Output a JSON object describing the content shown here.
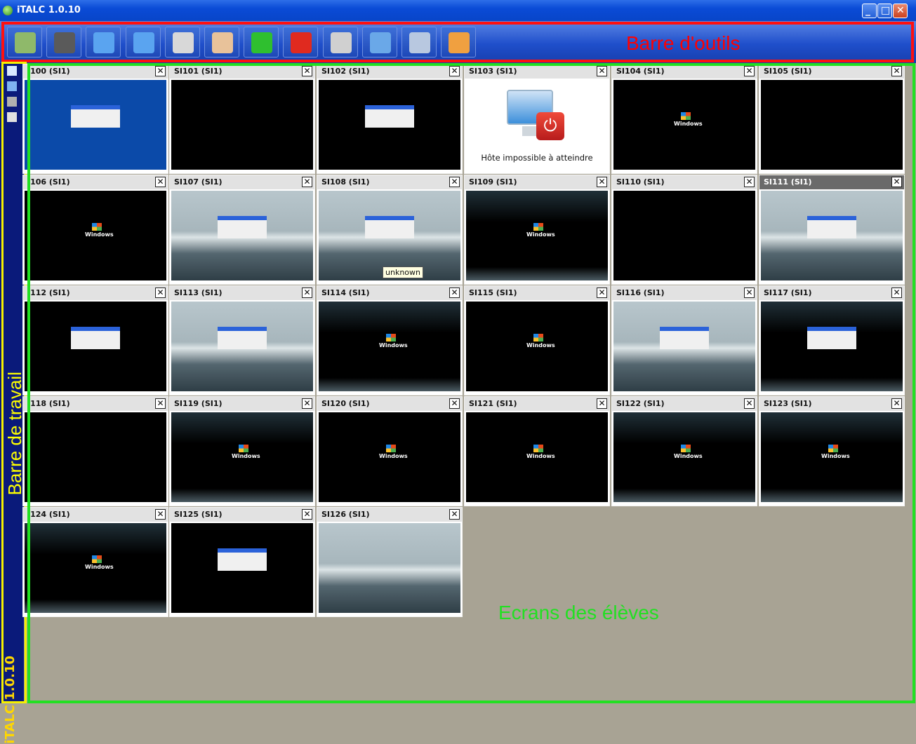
{
  "window": {
    "title": "iTALC 1.0.10"
  },
  "toolbar": {
    "label": "Barre d'outils",
    "buttons": [
      {
        "name": "classroom-button",
        "icon": "classroom-icon",
        "color": "#8fb96a"
      },
      {
        "name": "overview-button",
        "icon": "binoculars-icon",
        "color": "#5a5a5a"
      },
      {
        "name": "fullscreen-demo-button",
        "icon": "demo-icon",
        "color": "#5aa4f0"
      },
      {
        "name": "window-demo-button",
        "icon": "window-demo-icon",
        "color": "#5aa4f0"
      },
      {
        "name": "lock-button",
        "icon": "lock-icon",
        "color": "#d8d8d8"
      },
      {
        "name": "message-button",
        "icon": "message-icon",
        "color": "#e8c29a"
      },
      {
        "name": "power-on-button",
        "icon": "power-on-icon",
        "color": "#2fbf2f"
      },
      {
        "name": "power-off-button",
        "icon": "power-off-icon",
        "color": "#e02a1f"
      },
      {
        "name": "logon-button",
        "icon": "logon-icon",
        "color": "#d0d0d0"
      },
      {
        "name": "remote-control-button",
        "icon": "remote-control-icon",
        "color": "#6aa8e8"
      },
      {
        "name": "zoom-button",
        "icon": "magnifier-icon",
        "color": "#b8c8e0"
      },
      {
        "name": "refresh-button",
        "icon": "refresh-icon",
        "color": "#f0a040"
      }
    ]
  },
  "workbar": {
    "label": "Barre de travail",
    "version": "iTALC 1.0.10",
    "icons": [
      "home-icon",
      "screenshot-icon",
      "users-icon",
      "settings-icon"
    ]
  },
  "screens": {
    "label": "Ecrans des élèves",
    "tooltip": "unknown",
    "unreachable_text": "Hôte impossible à atteindre",
    "tiles": [
      {
        "name": "I100 (SI1)",
        "style": "blue"
      },
      {
        "name": "SI101 (SI1)",
        "style": "black"
      },
      {
        "name": "SI102 (SI1)",
        "style": "black-dialog"
      },
      {
        "name": "SI103 (SI1)",
        "style": "unreachable"
      },
      {
        "name": "SI104 (SI1)",
        "style": "black-logo"
      },
      {
        "name": "SI105 (SI1)",
        "style": "black"
      },
      {
        "name": "I106 (SI1)",
        "style": "black-logo"
      },
      {
        "name": "SI107 (SI1)",
        "style": "desk-dialog"
      },
      {
        "name": "SI108 (SI1)",
        "style": "desk-dialog"
      },
      {
        "name": "SI109 (SI1)",
        "style": "blob-logo"
      },
      {
        "name": "SI110 (SI1)",
        "style": "black"
      },
      {
        "name": "SI111 (SI1)",
        "style": "desk-dialog",
        "selected": true
      },
      {
        "name": "I112 (SI1)",
        "style": "black-dialog"
      },
      {
        "name": "SI113 (SI1)",
        "style": "desk-dialog"
      },
      {
        "name": "SI114 (SI1)",
        "style": "blob-logo"
      },
      {
        "name": "SI115 (SI1)",
        "style": "black-logo"
      },
      {
        "name": "SI116 (SI1)",
        "style": "desk-dialog"
      },
      {
        "name": "SI117 (SI1)",
        "style": "blob-dialog"
      },
      {
        "name": "I118 (SI1)",
        "style": "black"
      },
      {
        "name": "SI119 (SI1)",
        "style": "blob-logo"
      },
      {
        "name": "SI120 (SI1)",
        "style": "black-logo"
      },
      {
        "name": "SI121 (SI1)",
        "style": "black-logo"
      },
      {
        "name": "SI122 (SI1)",
        "style": "blob-logo"
      },
      {
        "name": "SI123 (SI1)",
        "style": "blob-logo"
      },
      {
        "name": "I124 (SI1)",
        "style": "blob-logo"
      },
      {
        "name": "SI125 (SI1)",
        "style": "black-dialog"
      },
      {
        "name": "SI126 (SI1)",
        "style": "desk"
      }
    ]
  }
}
